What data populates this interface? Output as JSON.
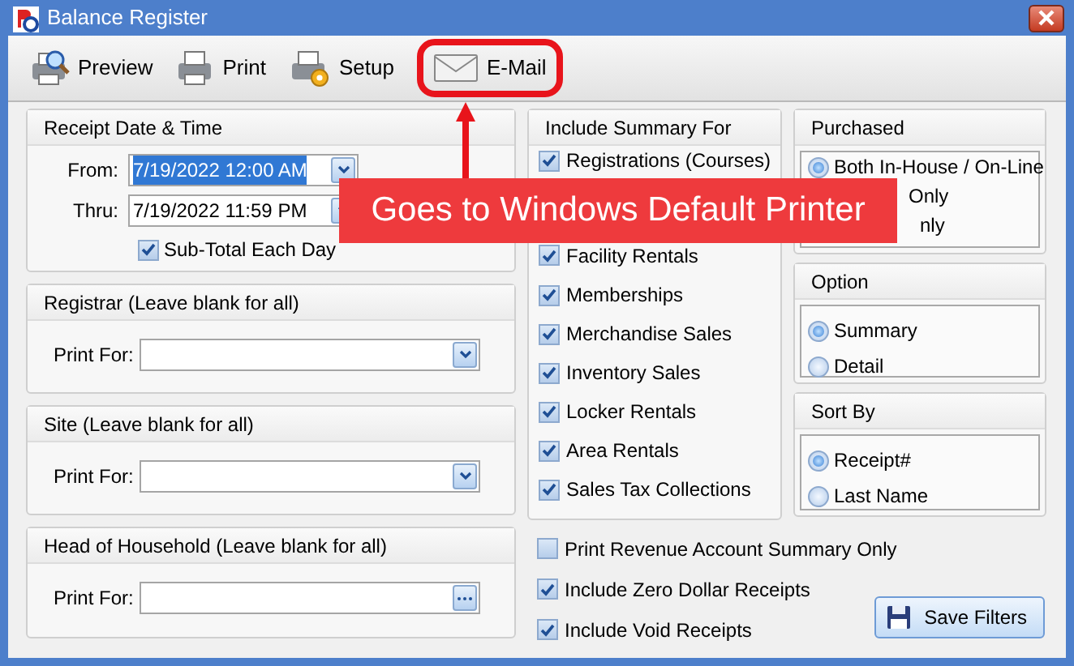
{
  "window": {
    "title": "Balance Register"
  },
  "toolbar": [
    {
      "label": "Preview",
      "kind": "preview",
      "highlighted": false
    },
    {
      "label": "Print",
      "kind": "print",
      "highlighted": false
    },
    {
      "label": "Setup",
      "kind": "setup",
      "highlighted": false
    },
    {
      "label": "E-Mail",
      "kind": "email",
      "highlighted": true
    }
  ],
  "receipt_group": {
    "title": "Receipt Date & Time",
    "from": {
      "label": "From:",
      "value": "7/19/2022 12:00 AM",
      "selected": true
    },
    "thru": {
      "label": "Thru:",
      "value": "7/19/2022 11:59 PM",
      "selected": false
    },
    "subtotal": {
      "label": "Sub-Total Each Day",
      "checked": true
    }
  },
  "filter_groups": [
    {
      "title": "Registrar (Leave blank for all)",
      "label": "Print For:",
      "kind": "dropdown"
    },
    {
      "title": "Site (Leave blank for all)",
      "label": "Print For:",
      "kind": "dropdown"
    },
    {
      "title": "Head of Household (Leave blank for all)",
      "label": "Print For:",
      "kind": "browse"
    }
  ],
  "summary_group": {
    "title": "Include Summary For",
    "items": [
      {
        "label": "Registrations (Courses)",
        "checked": true,
        "kind": "checkbox"
      },
      {
        "kind": "covered"
      },
      {
        "label": "Facility Rentals",
        "checked": true,
        "kind": "checkbox"
      },
      {
        "label": "Memberships",
        "checked": true,
        "kind": "checkbox"
      },
      {
        "label": "Merchandise Sales",
        "checked": true,
        "kind": "checkbox"
      },
      {
        "label": "Inventory Sales",
        "checked": true,
        "kind": "checkbox"
      },
      {
        "label": "Locker Rentals",
        "checked": true,
        "kind": "checkbox"
      },
      {
        "label": "Area Rentals",
        "checked": true,
        "kind": "checkbox"
      },
      {
        "label": "Sales Tax Collections",
        "checked": true,
        "kind": "checkbox"
      }
    ]
  },
  "options": [
    {
      "label": "Print Revenue Account Summary Only",
      "checked": false
    },
    {
      "label": "Include Zero Dollar Receipts",
      "checked": true
    },
    {
      "label": "Include Void Receipts",
      "checked": true
    }
  ],
  "radio_groups": [
    {
      "title": "Purchased",
      "items": [
        {
          "label": "Both In-House / On-Line",
          "selected": true,
          "kind": "radio"
        },
        {
          "label": "Only",
          "kind": "partial"
        },
        {
          "label": "nly",
          "kind": "partial"
        }
      ]
    },
    {
      "title": "Option",
      "items": [
        {
          "label": "Summary",
          "selected": true,
          "kind": "radio"
        },
        {
          "label": "Detail",
          "selected": false,
          "kind": "radio"
        }
      ]
    },
    {
      "title": "Sort By",
      "items": [
        {
          "label": "Receipt#",
          "selected": true,
          "kind": "radio"
        },
        {
          "label": "Last Name",
          "selected": false,
          "kind": "radio"
        }
      ]
    }
  ],
  "save_button": {
    "label": "Save Filters"
  },
  "callout": {
    "text": "Goes to Windows Default Printer"
  }
}
